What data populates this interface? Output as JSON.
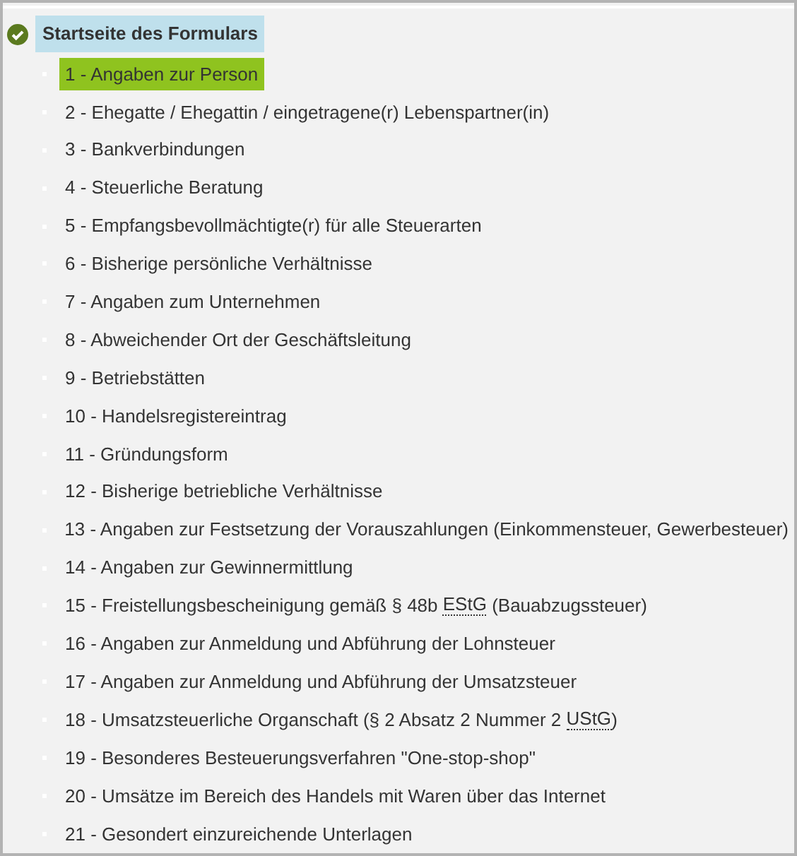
{
  "root": {
    "label": "Startseite des Formulars",
    "completed": true
  },
  "items": [
    {
      "parts": [
        {
          "kind": "text",
          "text": "1 - Angaben zur Person"
        }
      ],
      "selected": true
    },
    {
      "parts": [
        {
          "kind": "text",
          "text": "2 - Ehegatte / Ehegattin / eingetragene(r) Lebenspartner(in)"
        }
      ],
      "selected": false
    },
    {
      "parts": [
        {
          "kind": "text",
          "text": "3 - Bankverbindungen"
        }
      ],
      "selected": false
    },
    {
      "parts": [
        {
          "kind": "text",
          "text": "4 - Steuerliche Beratung"
        }
      ],
      "selected": false
    },
    {
      "parts": [
        {
          "kind": "text",
          "text": "5 - Empfangsbevollmächtigte(r) für alle Steuerarten"
        }
      ],
      "selected": false
    },
    {
      "parts": [
        {
          "kind": "text",
          "text": "6 - Bisherige persönliche Verhältnisse"
        }
      ],
      "selected": false
    },
    {
      "parts": [
        {
          "kind": "text",
          "text": "7 - Angaben zum Unternehmen"
        }
      ],
      "selected": false
    },
    {
      "parts": [
        {
          "kind": "text",
          "text": "8 - Abweichender Ort der Geschäftsleitung"
        }
      ],
      "selected": false
    },
    {
      "parts": [
        {
          "kind": "text",
          "text": "9 - Betriebstätten"
        }
      ],
      "selected": false
    },
    {
      "parts": [
        {
          "kind": "text",
          "text": "10 - Handelsregistereintrag"
        }
      ],
      "selected": false
    },
    {
      "parts": [
        {
          "kind": "text",
          "text": "11 - Gründungsform"
        }
      ],
      "selected": false
    },
    {
      "parts": [
        {
          "kind": "text",
          "text": "12 - Bisherige betriebliche Verhältnisse"
        }
      ],
      "selected": false
    },
    {
      "parts": [
        {
          "kind": "text",
          "text": "13 - Angaben zur Festsetzung der Vorauszahlungen (Einkommensteuer, Gewerbesteuer)"
        }
      ],
      "selected": false
    },
    {
      "parts": [
        {
          "kind": "text",
          "text": "14 - Angaben zur Gewinnermittlung"
        }
      ],
      "selected": false
    },
    {
      "parts": [
        {
          "kind": "text",
          "text": "15 - Freistellungsbescheinigung gemäß § 48b "
        },
        {
          "kind": "abbr",
          "text": "EStG"
        },
        {
          "kind": "text",
          "text": " (Bauabzugssteuer)"
        }
      ],
      "selected": false
    },
    {
      "parts": [
        {
          "kind": "text",
          "text": "16 - Angaben zur Anmeldung und Abführung der Lohnsteuer"
        }
      ],
      "selected": false
    },
    {
      "parts": [
        {
          "kind": "text",
          "text": "17 - Angaben zur Anmeldung und Abführung der Umsatzsteuer"
        }
      ],
      "selected": false
    },
    {
      "parts": [
        {
          "kind": "text",
          "text": "18 - Umsatzsteuerliche Organschaft (§ 2 Absatz 2 Nummer 2 "
        },
        {
          "kind": "abbr",
          "text": "UStG"
        },
        {
          "kind": "text",
          "text": ")"
        }
      ],
      "selected": false
    },
    {
      "parts": [
        {
          "kind": "text",
          "text": "19 - Besonderes Besteuerungsverfahren \"One-stop-shop\""
        }
      ],
      "selected": false
    },
    {
      "parts": [
        {
          "kind": "text",
          "text": "20 - Umsätze im Bereich des Handels mit Waren über das Internet"
        }
      ],
      "selected": false
    },
    {
      "parts": [
        {
          "kind": "text",
          "text": "21 - Gesondert einzureichende Unterlagen"
        }
      ],
      "selected": false
    }
  ]
}
